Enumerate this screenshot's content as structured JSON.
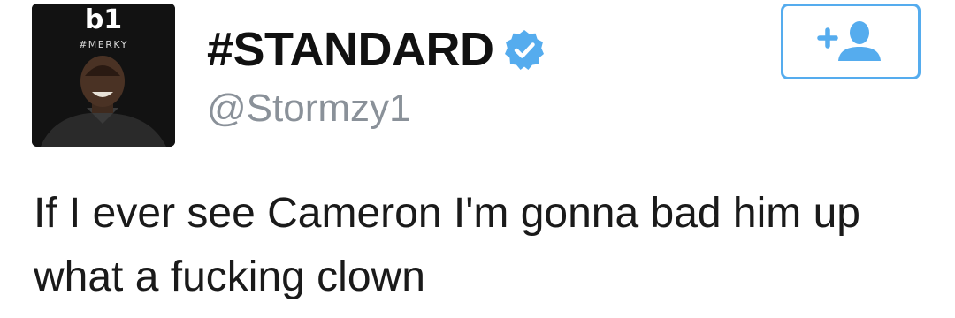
{
  "profile": {
    "avatar_logo": "b1",
    "avatar_tag": "#MERKY",
    "display_name": "#STANDARD",
    "handle": "@Stormzy1",
    "verified": true,
    "verified_icon": "verified-badge-icon"
  },
  "follow_button": {
    "icon": "add-user-icon",
    "accent_color": "#55acee"
  },
  "tweet": {
    "text": "If I ever see Cameron I'm gonna bad him up what a fucking clown"
  },
  "colors": {
    "text": "#111111",
    "handle": "#8a9199",
    "accent": "#55acee"
  }
}
